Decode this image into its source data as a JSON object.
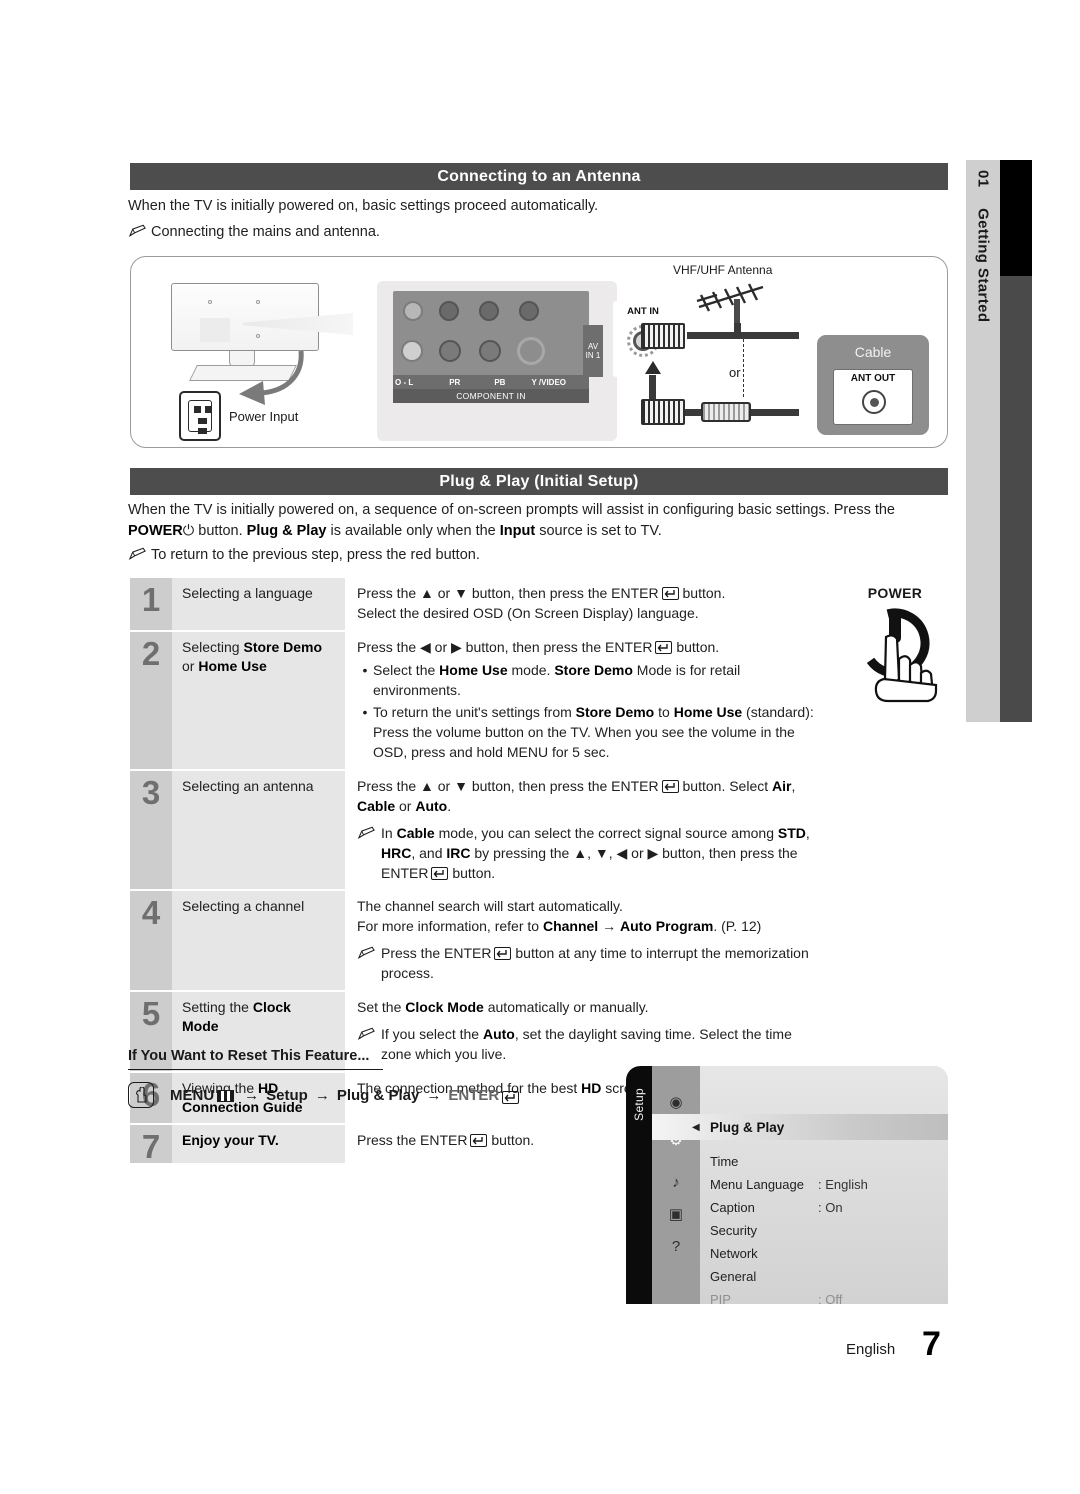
{
  "sidebar": {
    "chapter_number": "01",
    "chapter_title": "Getting Started"
  },
  "sections": {
    "antenna": {
      "heading": "Connecting to an Antenna",
      "paragraph": "When the TV is initially powered on, basic settings proceed automatically.",
      "note": "Connecting the mains and antenna."
    },
    "plug_play": {
      "heading": "Plug & Play (Initial Setup)",
      "paragraph_part1": "When the TV is initially powered on, a sequence of on-screen prompts will assist in configuring basic settings. Press the ",
      "power_label": "POWER",
      "paragraph_part2": " button. ",
      "plug_play_bold": "Plug & Play",
      "paragraph_part3": " is available only when the ",
      "input_bold": "Input",
      "paragraph_part4": " source is set to TV.",
      "note": "To return to the previous step, press the red button."
    }
  },
  "diagram": {
    "labels": {
      "vhf_antenna": "VHF/UHF Antenna",
      "ant_in": "ANT IN",
      "ant_out": "ANT OUT",
      "cable": "Cable",
      "or": "or",
      "power_input": "Power Input",
      "av_in_1_line1": "AV",
      "av_in_1_line2": "IN 1",
      "component_in": "COMPONENT IN",
      "jack_audio_l": "O - L",
      "jack_pr": "PR",
      "jack_pb": "PB",
      "jack_y_video": "Y /VIDEO"
    }
  },
  "steps": [
    {
      "number": "1",
      "title_plain": "Selecting a language",
      "title_bold": "",
      "title_line2": "",
      "desc_lines": [
        "Press the ▲ or ▼ button, then press the ENTER↵ button.",
        "Select the desired OSD (On Screen Display) language."
      ],
      "bullets": [],
      "notes": []
    },
    {
      "number": "2",
      "title_plain": "Selecting ",
      "title_bold": "Store Demo",
      "title_line2": "or Home Use",
      "desc_lines": [
        "Press the ◀ or ▶ button, then press the ENTER↵ button."
      ],
      "bullets": [
        "Select the Home Use mode. Store Demo Mode is for retail environments.",
        "To return the unit's settings from Store Demo to Home Use (standard): Press the volume button on the TV. When you see the volume in the OSD, press and hold MENU for 5 sec."
      ],
      "notes": []
    },
    {
      "number": "3",
      "title_plain": "Selecting an antenna",
      "title_bold": "",
      "title_line2": "",
      "desc_lines": [
        "Press the ▲ or ▼ button, then press the ENTER↵ button. Select Air, Cable or Auto."
      ],
      "bullets": [],
      "notes": [
        "In Cable mode, you can select the correct signal source among STD, HRC, and IRC by pressing the ▲, ▼, ◀ or ▶ button, then press the ENTER↵ button."
      ]
    },
    {
      "number": "4",
      "title_plain": "Selecting a channel",
      "title_bold": "",
      "title_line2": "",
      "desc_lines": [
        "The channel search will start automatically.",
        "For more information, refer to Channel → Auto Program. (P. 12)"
      ],
      "bullets": [],
      "notes": [
        "Press the ENTER↵ button at any time to interrupt the memorization process."
      ]
    },
    {
      "number": "5",
      "title_plain": "Setting the ",
      "title_bold": "Clock",
      "title_line2": "Mode",
      "desc_lines": [
        "Set the Clock Mode automatically or manually."
      ],
      "bullets": [],
      "notes": [
        "If you select the Auto, set the daylight saving time. Select the time zone which you live."
      ]
    },
    {
      "number": "6",
      "title_plain": "Viewing the ",
      "title_bold": "HD",
      "title_line2": "Connection Guide",
      "desc_lines": [
        "The connection method for the best HD screen quality is displayed."
      ],
      "bullets": [],
      "notes": []
    },
    {
      "number": "7",
      "title_plain": "",
      "title_bold": "Enjoy your TV.",
      "title_line2": "",
      "desc_lines": [
        "Press the ENTER↵ button."
      ],
      "bullets": [],
      "notes": []
    }
  ],
  "power_art": {
    "label": "POWER"
  },
  "reset": {
    "heading": "If You Want to Reset This Feature...",
    "path_menu": "MENU",
    "arrow": "→",
    "path_setup": "Setup",
    "path_plugplay": "Plug & Play",
    "path_enter": "ENTER"
  },
  "osd": {
    "tab_label": "Setup",
    "selected_item": "Plug & Play",
    "items": [
      {
        "label": "Time",
        "value": ""
      },
      {
        "label": "Menu Language",
        "value": ": English"
      },
      {
        "label": "Caption",
        "value": ": On"
      },
      {
        "label": "Security",
        "value": ""
      },
      {
        "label": "Network",
        "value": ""
      },
      {
        "label": "General",
        "value": ""
      },
      {
        "label": "PIP",
        "value": ": Off"
      }
    ]
  },
  "footer": {
    "language": "English",
    "page_number": "7"
  },
  "colors": {
    "header_bar": "#4d4d4d",
    "step_number_bg": "#cdcdcd",
    "step_title_bg": "#e6e6e6",
    "sidebar_gray": "#cfcfcf",
    "sidebar_black": "#000000"
  }
}
